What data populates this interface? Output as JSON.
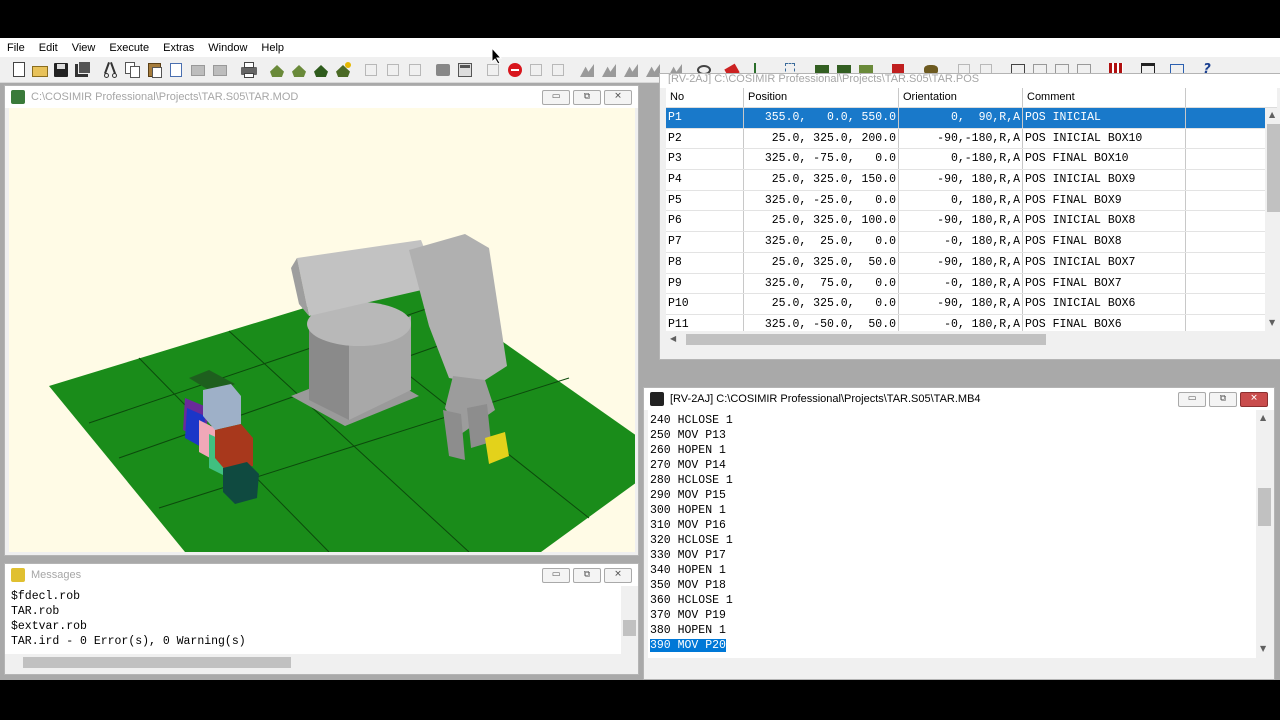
{
  "menu": [
    "File",
    "Edit",
    "View",
    "Execute",
    "Extras",
    "Window",
    "Help"
  ],
  "robot_view": {
    "title": "C:\\COSIMIR Professional\\Projects\\TAR.S05\\TAR.MOD"
  },
  "messages": {
    "title": "Messages",
    "lines": [
      "$fdecl.rob",
      "TAR.rob",
      "$extvar.rob",
      "TAR.ird - 0 Error(s), 0 Warning(s)"
    ]
  },
  "positions": {
    "title": "[RV-2AJ] C:\\COSIMIR Professional\\Projects\\TAR.S05\\TAR.POS",
    "headers": [
      "No",
      "Position",
      "Orientation",
      "Comment"
    ],
    "rows": [
      {
        "no": "P1",
        "position": "355.0,   0.0, 550.0",
        "orientation": "0,  90,R,A",
        "comment": "POS INICIAL"
      },
      {
        "no": "P2",
        "position": "25.0, 325.0, 200.0",
        "orientation": "-90,-180,R,A",
        "comment": "POS INICIAL BOX10"
      },
      {
        "no": "P3",
        "position": "325.0, -75.0,   0.0",
        "orientation": "0,-180,R,A",
        "comment": "POS FINAL BOX10"
      },
      {
        "no": "P4",
        "position": "25.0, 325.0, 150.0",
        "orientation": "-90, 180,R,A",
        "comment": "POS INICIAL BOX9"
      },
      {
        "no": "P5",
        "position": "325.0, -25.0,   0.0",
        "orientation": "0, 180,R,A",
        "comment": "POS FINAL BOX9"
      },
      {
        "no": "P6",
        "position": "25.0, 325.0, 100.0",
        "orientation": "-90, 180,R,A",
        "comment": "POS INICIAL BOX8"
      },
      {
        "no": "P7",
        "position": "325.0,  25.0,   0.0",
        "orientation": "-0, 180,R,A",
        "comment": "POS FINAL BOX8"
      },
      {
        "no": "P8",
        "position": "25.0, 325.0,  50.0",
        "orientation": "-90, 180,R,A",
        "comment": "POS INICIAL BOX7"
      },
      {
        "no": "P9",
        "position": "325.0,  75.0,   0.0",
        "orientation": "-0, 180,R,A",
        "comment": "POS FINAL BOX7"
      },
      {
        "no": "P10",
        "position": "25.0, 325.0,   0.0",
        "orientation": "-90, 180,R,A",
        "comment": "POS INICIAL BOX6"
      },
      {
        "no": "P11",
        "position": "325.0, -50.0,  50.0",
        "orientation": "-0, 180,R,A",
        "comment": "POS FINAL BOX6"
      }
    ]
  },
  "program": {
    "title": "[RV-2AJ] C:\\COSIMIR Professional\\Projects\\TAR.S05\\TAR.MB4",
    "lines": [
      "240 HCLOSE 1",
      "250 MOV P13",
      "260 HOPEN 1",
      "270 MOV P14",
      "280 HCLOSE 1",
      "290 MOV P15",
      "300 HOPEN 1",
      "310 MOV P16",
      "320 HCLOSE 1",
      "330 MOV P17",
      "340 HOPEN 1",
      "350 MOV P18",
      "360 HCLOSE 1",
      "370 MOV P19",
      "380 HOPEN 1",
      "390 MOV P20"
    ],
    "selected_line": "390 MOV P20"
  },
  "window_buttons": {
    "minimize": "▭",
    "restore": "⧉",
    "close": "✕"
  },
  "colors": {
    "selection": "#1979ca",
    "floor": "#1a8c1a",
    "viewport_bg": "#fffbe6"
  }
}
